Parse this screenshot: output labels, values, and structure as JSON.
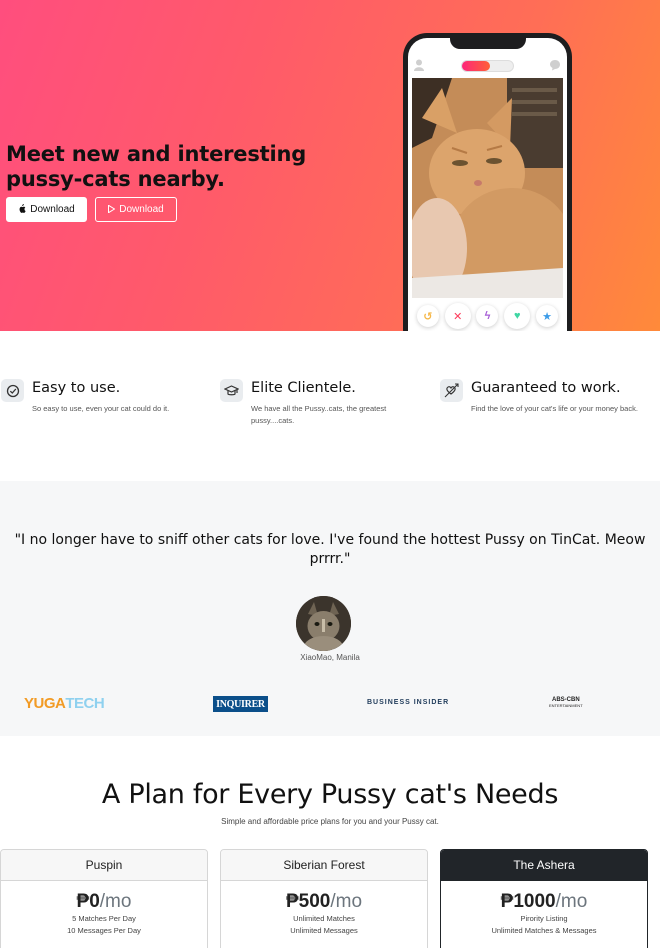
{
  "hero": {
    "title": "Meet new and interesting pussy-cats nearby.",
    "download_apple": "Download",
    "download_play": "Download"
  },
  "features": [
    {
      "icon": "check-circle-icon",
      "title": "Easy to use.",
      "text": "So easy to use, even your cat could do it."
    },
    {
      "icon": "graduation-cap-icon",
      "title": "Elite Clientele.",
      "text": "We have all the Pussy..cats, the greatest pussy....cats."
    },
    {
      "icon": "heart-arrow-icon",
      "title": "Guaranteed to work.",
      "text": "Find the love of your cat's life or your money back."
    }
  ],
  "testimonial": {
    "quote": "\"I no longer have to sniff other cats for love. I've found the hottest Pussy on TinCat. Meow prrrr.\"",
    "author": "XiaoMao, Manila"
  },
  "logos": {
    "yugatech_a": "YUGA",
    "yugatech_b": "TECH",
    "inquirer_top": "PHILIPPINE DAILY",
    "inquirer": "INQUIRER",
    "business_insider": "BUSINESS INSIDER",
    "abscbn": "ABS-CBN",
    "abscbn_sub": "ENTERTAINMENT"
  },
  "pricing": {
    "title": "A Plan for Every Pussy cat's Needs",
    "subtitle": "Simple and affordable price plans for you and your Pussy cat.",
    "plans": [
      {
        "name": "Puspin",
        "price": "₱0",
        "period": "/mo",
        "features": [
          "5 Matches Per Day",
          "10 Messages Per Day"
        ]
      },
      {
        "name": "Siberian Forest",
        "price": "₱500",
        "period": "/mo",
        "features": [
          "Unlimited Matches",
          "Unlimited Messages"
        ]
      },
      {
        "name": "The Ashera",
        "price": "₱1000",
        "period": "/mo",
        "features": [
          "Pirority Listing",
          "Unlimited Matches & Messages"
        ]
      }
    ]
  },
  "colors": {
    "hero_gradient_start": "#ff4e7e",
    "hero_gradient_end": "#ff8a3a",
    "dark": "#212529"
  }
}
